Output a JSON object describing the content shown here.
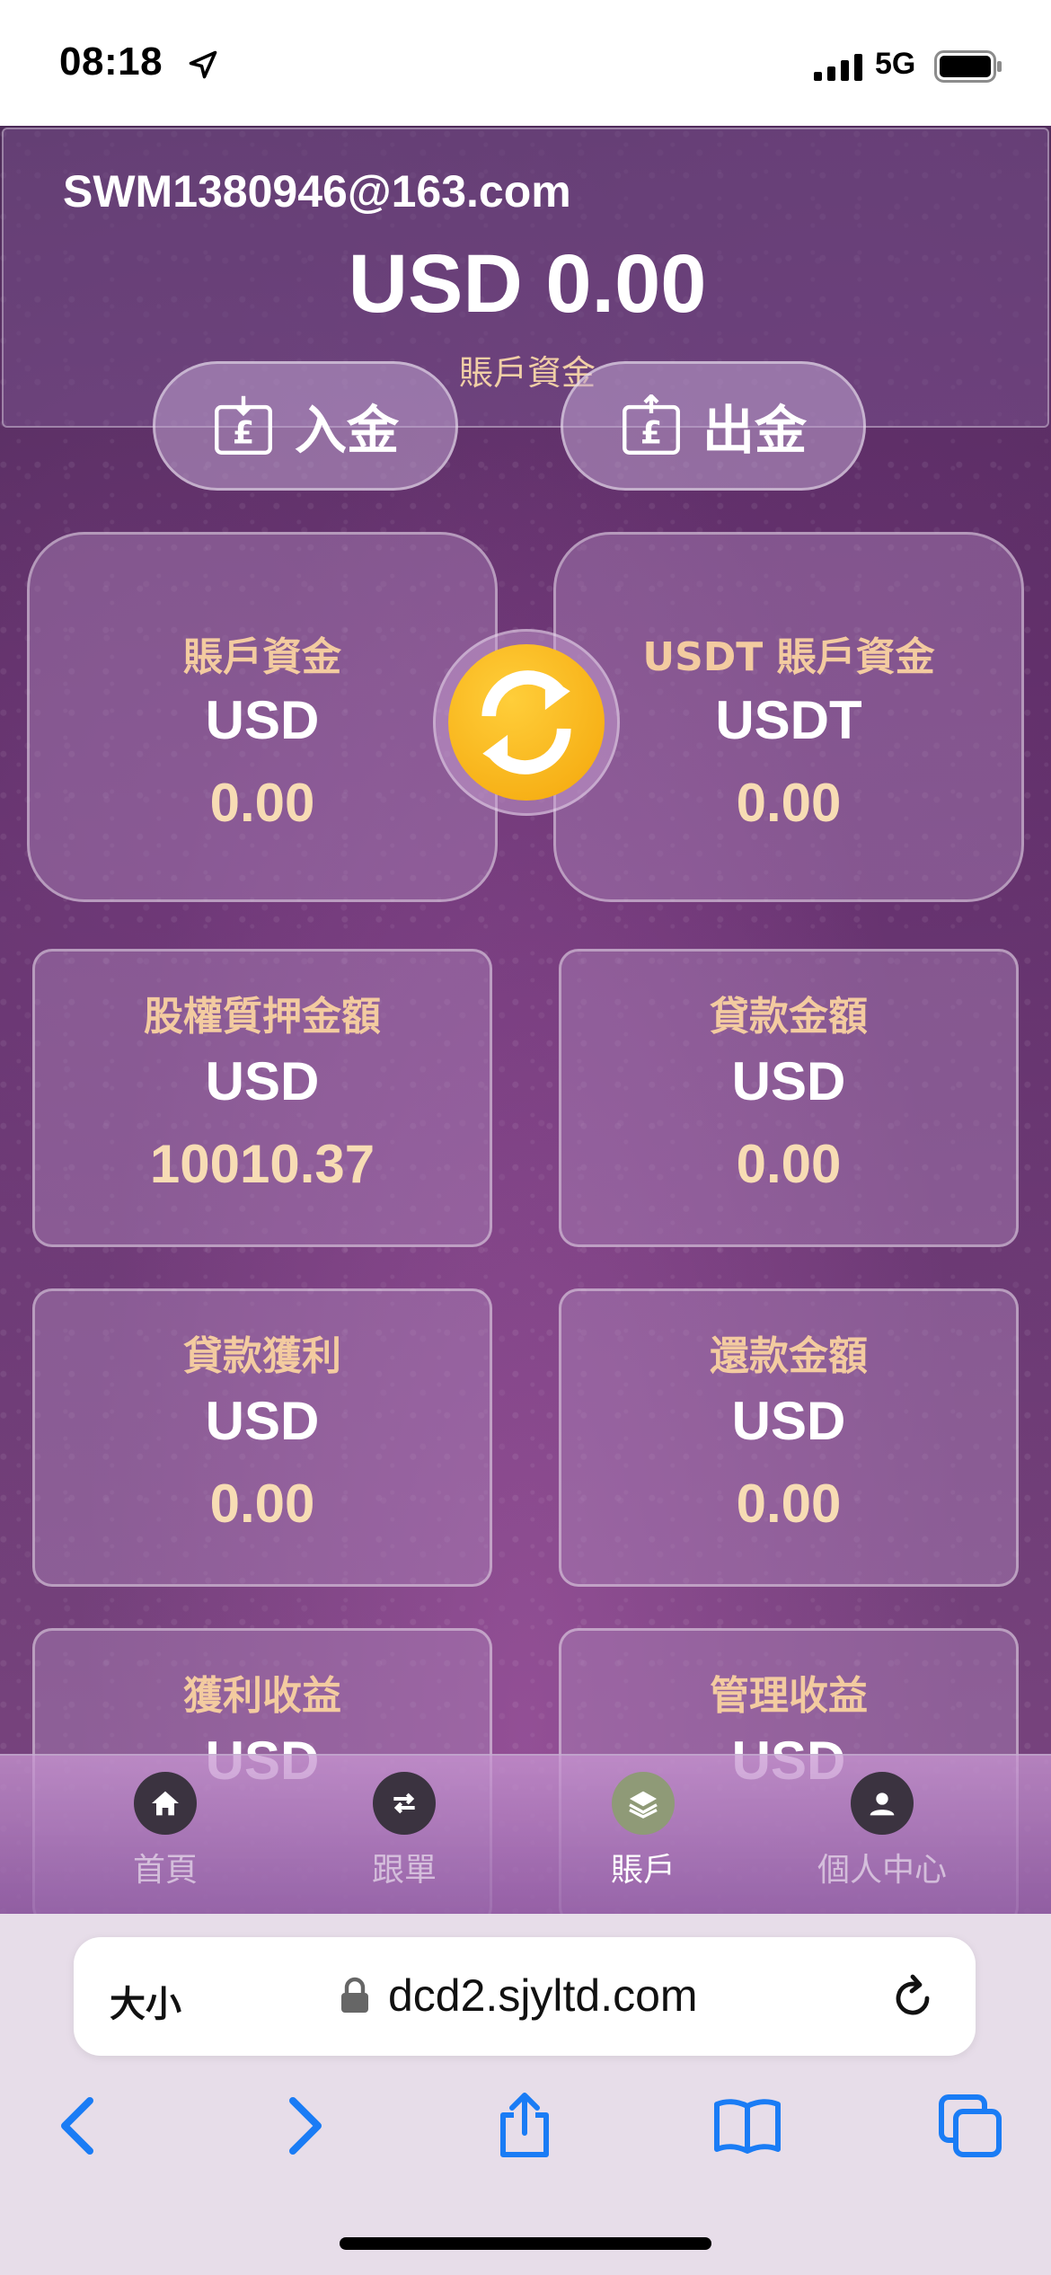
{
  "status_bar": {
    "time": "08:18",
    "network": "5G",
    "icons": [
      "location-arrow-icon",
      "signal-icon",
      "battery-icon"
    ]
  },
  "account": {
    "email": "SWM1380946@163.com",
    "total_balance": "USD 0.00",
    "balance_caption": "賬戶資金"
  },
  "actions": {
    "deposit_label": "入金",
    "withdraw_label": "出金"
  },
  "cards": [
    {
      "title": "賬戶資金",
      "currency": "USD",
      "value": "0.00"
    },
    {
      "title": "USDT 賬戶資金",
      "currency": "USDT",
      "value": "0.00"
    },
    {
      "title": "股權質押金額",
      "currency": "USD",
      "value": "10010.37"
    },
    {
      "title": "貸款金額",
      "currency": "USD",
      "value": "0.00"
    },
    {
      "title": "貸款獲利",
      "currency": "USD",
      "value": "0.00"
    },
    {
      "title": "還款金額",
      "currency": "USD",
      "value": "0.00"
    },
    {
      "title": "獲利收益",
      "currency": "USD",
      "value": ""
    },
    {
      "title": "管理收益",
      "currency": "USD",
      "value": ""
    }
  ],
  "tabs": [
    {
      "label": "首頁",
      "icon": "home-icon",
      "active": false
    },
    {
      "label": "跟單",
      "icon": "swap-arrows-icon",
      "active": false
    },
    {
      "label": "賬戶",
      "icon": "layers-icon",
      "active": true
    },
    {
      "label": "個人中心",
      "icon": "user-icon",
      "active": false
    }
  ],
  "browser": {
    "text_size_label": "大小",
    "url": "dcd2.sjyltd.com",
    "nav_icons": [
      "back-icon",
      "forward-icon",
      "share-icon",
      "bookmarks-icon",
      "tabs-icon"
    ]
  },
  "colors": {
    "accent_gold": "#f3cba0",
    "swap_yellow": "#f4a60a",
    "safari_blue": "#1a7cf5"
  }
}
